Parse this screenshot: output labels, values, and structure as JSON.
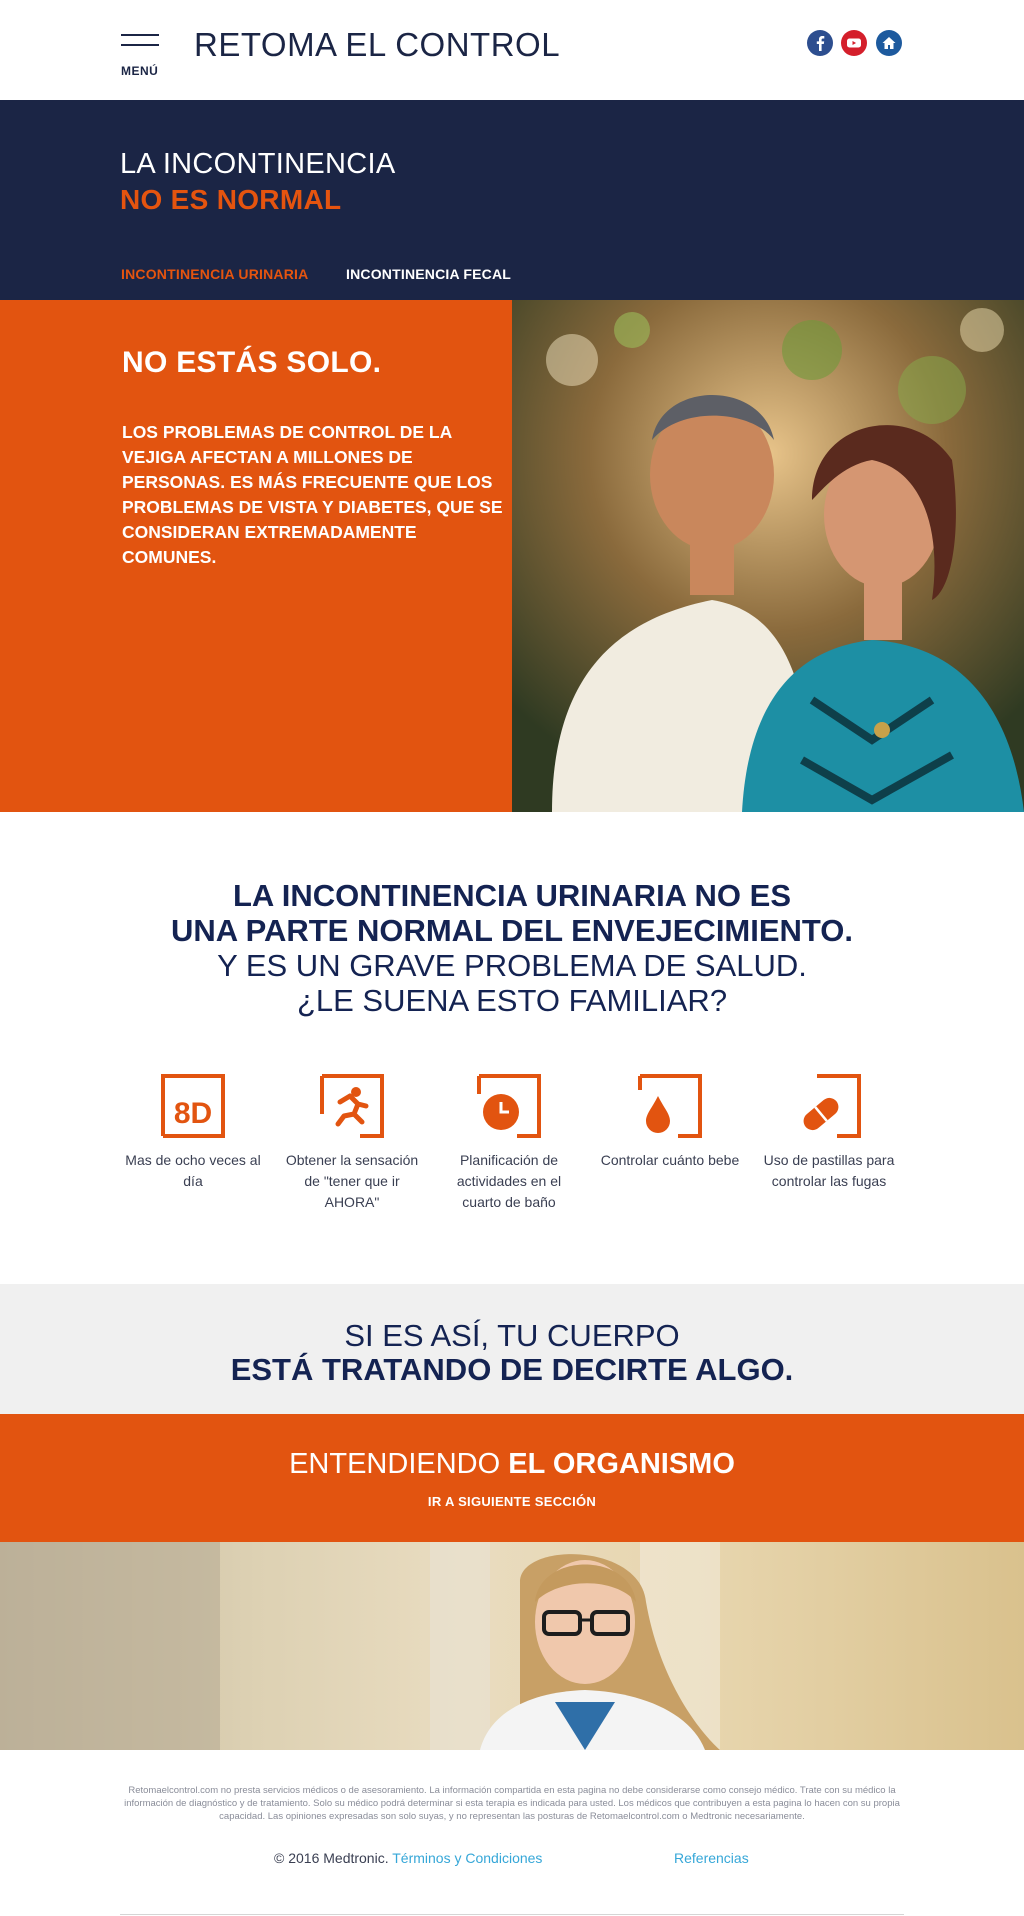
{
  "header": {
    "menu_label": "MENÚ",
    "site_title": "RETOMA EL CONTROL",
    "social": [
      "facebook-icon",
      "youtube-icon",
      "home-icon"
    ]
  },
  "hero": {
    "line1": "LA INCONTINENCIA",
    "line2": "NO ES NORMAL",
    "tabs": [
      {
        "label": "INCONTINENCIA URINARIA",
        "active": true
      },
      {
        "label": "INCONTINENCIA FECAL",
        "active": false
      }
    ]
  },
  "alone": {
    "title": "NO ESTÁS SOLO.",
    "body": "LOS PROBLEMAS DE CONTROL DE LA VEJIGA AFECTAN A MILLONES DE PERSONAS. ES MÁS FRECUENTE QUE LOS PROBLEMAS DE VISTA Y DIABETES, QUE SE CONSIDERAN EXTREMADAMENTE COMUNES."
  },
  "familiar": {
    "line1": "LA INCONTINENCIA URINARIA NO ES",
    "line2": "UNA PARTE NORMAL DEL ENVEJECIMIENTO.",
    "line3": "Y ES UN GRAVE PROBLEMA DE SALUD.",
    "line4": "¿LE SUENA ESTO FAMILIAR?",
    "symptoms": [
      {
        "icon": "eight-times-day-icon",
        "icon_text": "8D",
        "label": "Mas de ocho veces al día"
      },
      {
        "icon": "running-person-icon",
        "label": "Obtener la sensación de \"tener que ir AHORA\""
      },
      {
        "icon": "clock-icon",
        "label": "Planificación de actividades  en el cuarto de baño"
      },
      {
        "icon": "water-drop-icon",
        "label": "Controlar cuánto bebe"
      },
      {
        "icon": "pill-icon",
        "label": "Uso de pastillas para controlar las fugas"
      }
    ]
  },
  "message": {
    "line1": "SI ES ASÍ, TU CUERPO",
    "line2": "ESTÁ TRATANDO DE DECIRTE ALGO."
  },
  "cta": {
    "title_light": "ENTENDIENDO ",
    "title_bold": "EL ORGANISMO",
    "subtitle": "IR A SIGUIENTE SECCIÓN"
  },
  "footer": {
    "disclaimer": "Retomaelcontrol.com no presta servicios médicos o de asesoramiento. La información compartida en esta pagina no debe considerarse como consejo médico. Trate con su médico la información de diagnóstico y de tratamiento. Solo su médico podrá determinar si esta terapia es indicada para usted. Los médicos que contribuyen a esta pagina lo hacen con su propia capacidad. Las opiniones expresadas son solo suyas, y no representan las posturas de Retomaelcontrol.com o Medtronic necesariamente.",
    "copyright": "© 2016 Medtronic.",
    "terms": "Términos y Condiciones",
    "references": "Referencias"
  },
  "colors": {
    "navy": "#1b2545",
    "orange": "#e25410",
    "light_gray": "#f0f0f0",
    "link_blue": "#36a7d8"
  }
}
